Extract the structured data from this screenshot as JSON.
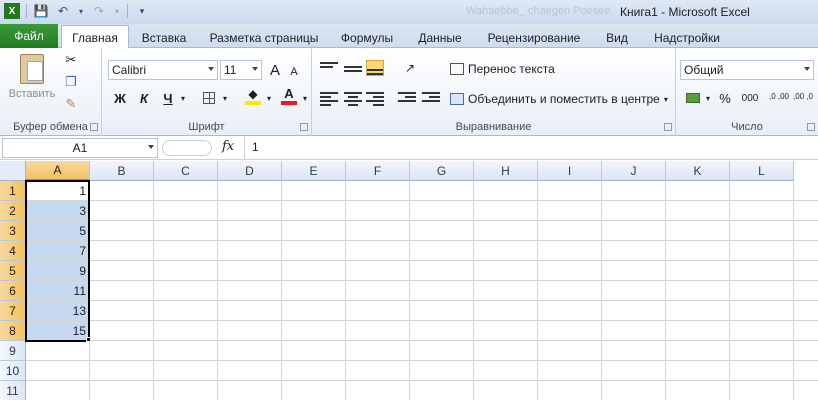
{
  "window": {
    "title": "Книга1  -  Microsoft Excel",
    "ghost_title": "Wahaebbe_ chaegen Poesee"
  },
  "tabs": [
    {
      "label": "Файл"
    },
    {
      "label": "Главная"
    },
    {
      "label": "Вставка"
    },
    {
      "label": "Разметка страницы"
    },
    {
      "label": "Формулы"
    },
    {
      "label": "Данные"
    },
    {
      "label": "Рецензирование"
    },
    {
      "label": "Вид"
    },
    {
      "label": "Надстройки"
    }
  ],
  "ribbon": {
    "clipboard": {
      "label": "Буфер обмена",
      "paste_label": "Вставить"
    },
    "font": {
      "label": "Шрифт",
      "font_name": "Calibri",
      "font_size": "11",
      "bold": "Ж",
      "italic": "К",
      "underline": "Ч",
      "grow": "A",
      "shrink": "A",
      "font_color_letter": "A"
    },
    "alignment": {
      "label": "Выравнивание",
      "wrap_text": "Перенос текста",
      "merge_center": "Объединить и поместить в центре"
    },
    "number": {
      "label": "Число",
      "format": "Общий",
      "percent": "%",
      "thousands": "000",
      "inc_decimal": ",0 ,00",
      "dec_decimal": ",00 ,0"
    }
  },
  "formula_bar": {
    "name_box": "A1",
    "fx": "fx",
    "value": "1"
  },
  "grid": {
    "columns": [
      "A",
      "B",
      "C",
      "D",
      "E",
      "F",
      "G",
      "H",
      "I",
      "J",
      "K",
      "L"
    ],
    "rows": [
      "1",
      "2",
      "3",
      "4",
      "5",
      "6",
      "7",
      "8",
      "9",
      "10",
      "11"
    ],
    "column_a_values": [
      "1",
      "3",
      "5",
      "7",
      "9",
      "11",
      "13",
      "15"
    ]
  },
  "colors": {
    "selection_fill": "#c6d9f1",
    "header_selected": "#f1c15f",
    "file_tab": "#1f7a1f",
    "accent_font_color": "#e01e1e",
    "highlight_yellow": "#ffe600"
  }
}
